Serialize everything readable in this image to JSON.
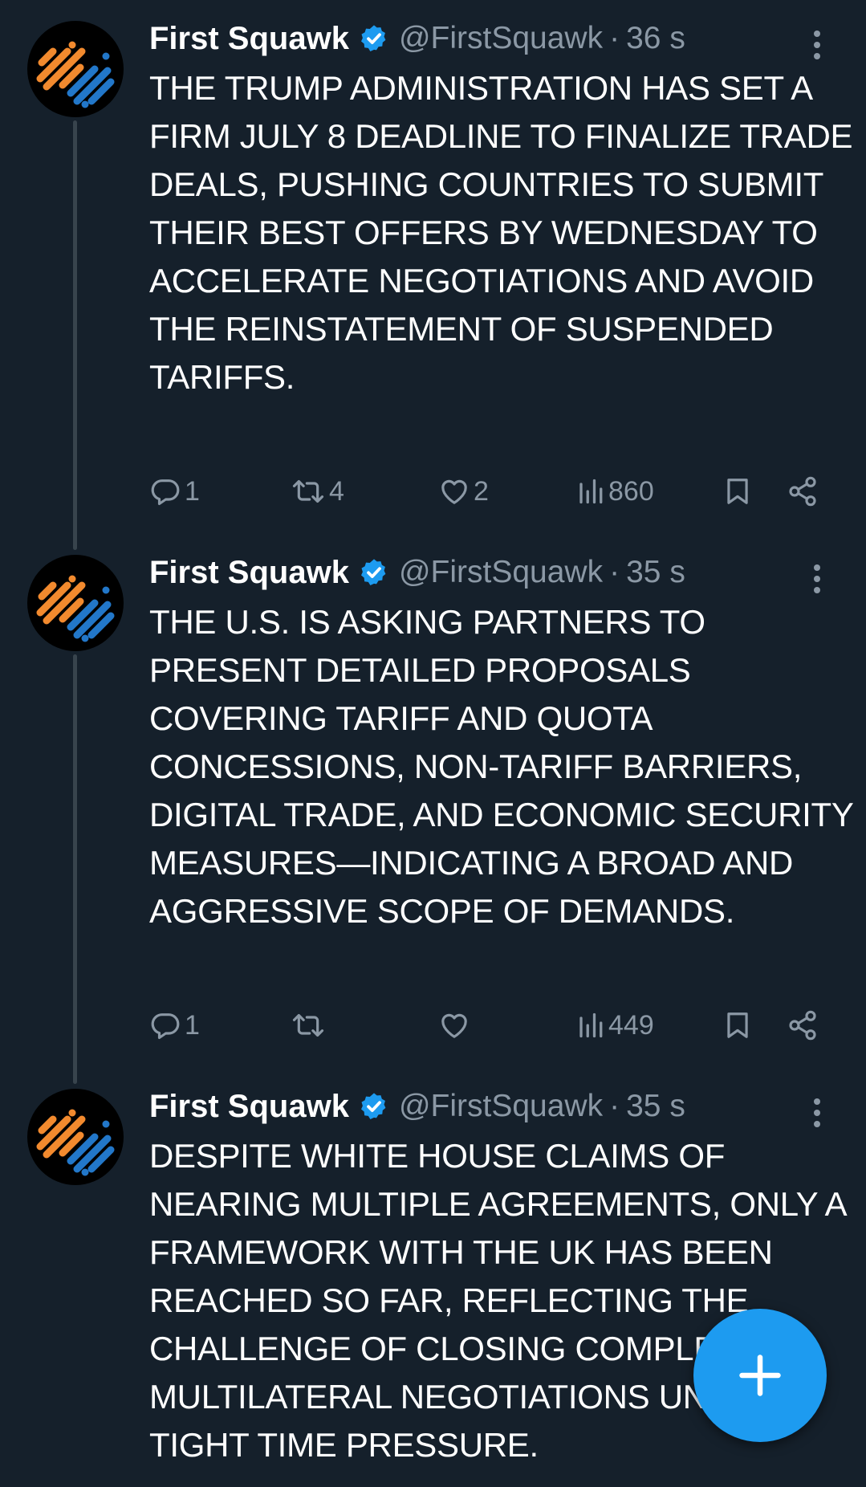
{
  "colors": {
    "background": "#15202b",
    "text_primary": "#ffffff",
    "text_secondary": "#8b98a5",
    "verified_badge": "#1d9bf0",
    "fab": "#1d9bf0",
    "thread_line": "#38444d",
    "avatar_orange": "#f28a2e",
    "avatar_blue": "#2277c9"
  },
  "icons": {
    "verified": "verified-badge-icon",
    "more": "more-vertical-icon",
    "reply": "reply-icon",
    "retweet": "retweet-icon",
    "like": "heart-icon",
    "views": "views-icon",
    "bookmark": "bookmark-icon",
    "share": "share-icon",
    "compose": "plus-icon"
  },
  "tweets": [
    {
      "author": "First Squawk",
      "handle": "@FirstSquawk",
      "separator": "·",
      "time": "36 s",
      "text": "THE TRUMP ADMINISTRATION HAS SET A FIRM JULY 8 DEADLINE TO FINALIZE TRADE DEALS, PUSHING COUNTRIES TO SUBMIT THEIR BEST OFFERS BY WEDNESDAY TO ACCELERATE NEGOTIATIONS AND AVOID THE REINSTATEMENT OF SUSPENDED TARIFFS.",
      "replies": "1",
      "retweets": "4",
      "likes": "2",
      "views": "860"
    },
    {
      "author": "First Squawk",
      "handle": "@FirstSquawk",
      "separator": "·",
      "time": "35 s",
      "text": "THE U.S. IS ASKING PARTNERS TO PRESENT DETAILED PROPOSALS COVERING TARIFF AND QUOTA CONCESSIONS, NON-TARIFF BARRIERS, DIGITAL TRADE, AND ECONOMIC SECURITY MEASURES—INDICATING A BROAD AND AGGRESSIVE SCOPE OF DEMANDS.",
      "replies": "1",
      "retweets": "",
      "likes": "",
      "views": "449"
    },
    {
      "author": "First Squawk",
      "handle": "@FirstSquawk",
      "separator": "·",
      "time": "35 s",
      "text": "DESPITE WHITE HOUSE CLAIMS OF NEARING MULTIPLE AGREEMENTS, ONLY A FRAMEWORK WITH THE UK HAS BEEN REACHED SO FAR, REFLECTING THE CHALLENGE OF CLOSING COMPLEX MULTILATERAL NEGOTIATIONS UNDER TIGHT TIME PRESSURE."
    }
  ]
}
